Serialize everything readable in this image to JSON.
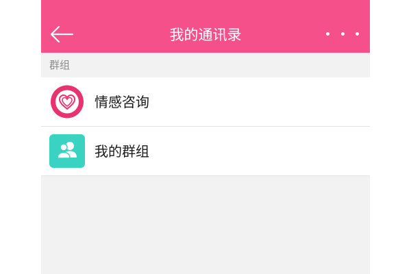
{
  "header": {
    "title": "我的通讯录",
    "back_icon": "back-arrow-icon",
    "more_icon": "more-dots-icon",
    "background_color": "#f5508a"
  },
  "section": {
    "label": "群组"
  },
  "items": [
    {
      "label": "情感咨询",
      "icon": "heart-icon",
      "icon_color": "#e8336f"
    },
    {
      "label": "我的群组",
      "icon": "group-icon",
      "icon_color": "#3ad3c2"
    }
  ]
}
